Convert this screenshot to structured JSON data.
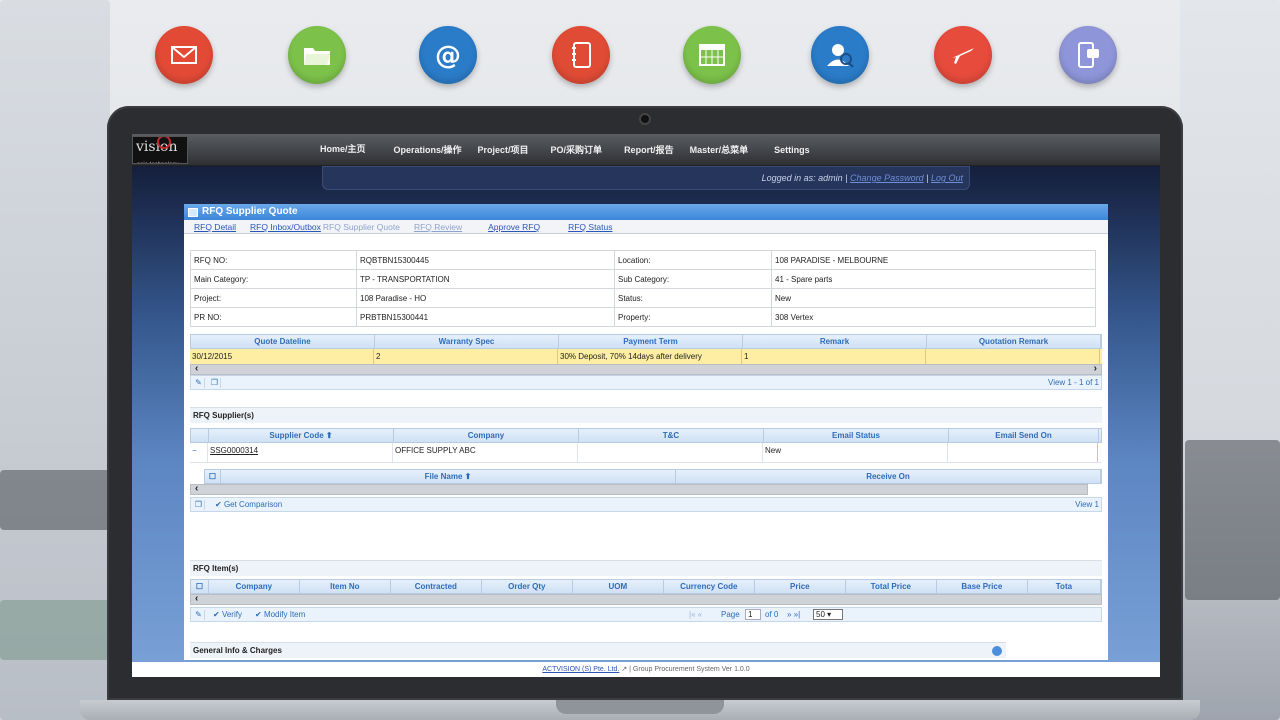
{
  "app_icons": [
    {
      "name": "mail-icon",
      "color": "#e24a36"
    },
    {
      "name": "folder-icon",
      "color": "#7cc24a"
    },
    {
      "name": "at-icon",
      "color": "#2a7bc8"
    },
    {
      "name": "notebook-icon",
      "color": "#e04b35"
    },
    {
      "name": "calendar-icon",
      "color": "#7cc24a"
    },
    {
      "name": "search-user-icon",
      "color": "#2a7bc8"
    },
    {
      "name": "plane-icon",
      "color": "#e64b3c"
    },
    {
      "name": "phone-chat-icon",
      "color": "#8e95d8"
    }
  ],
  "logo": {
    "text": "vision",
    "sub": "asia technology"
  },
  "nav": [
    "Home/主页",
    "Operations/操作",
    "Project/项目",
    "PO/采购订单",
    "Report/报告",
    "Master/总菜单",
    "Settings"
  ],
  "user": {
    "logged_in": "Logged in as: admin",
    "sep": "|",
    "change_password": "Change Password",
    "logout": "Log Out"
  },
  "panel": {
    "title": "RFQ Supplier Quote",
    "tabs": [
      "RFQ Detail",
      "RFQ Inbox/Outbox",
      "RFQ Supplier Quote",
      "RFQ Review",
      "Approve RFQ",
      "RFQ Status"
    ]
  },
  "info": {
    "rfq_no_label": "RFQ NO:",
    "rfq_no": "RQBTBN15300445",
    "location_label": "Location:",
    "location": "108 PARADISE - MELBOURNE",
    "main_cat_label": "Main Category:",
    "main_cat": "TP - TRANSPORTATION",
    "sub_cat_label": "Sub Category:",
    "sub_cat": "41 - Spare parts",
    "project_label": "Project:",
    "project": "108 Paradise - HO",
    "status_label": "Status:",
    "status": "New",
    "pr_no_label": "PR NO:",
    "pr_no": "PRBTBN15300441",
    "property_label": "Property:",
    "property": "308 Vertex"
  },
  "quote_grid": {
    "headers": [
      "Quote Dateline",
      "Warranty Spec",
      "Payment Term",
      "Remark",
      "Quotation Remark"
    ],
    "row": [
      "30/12/2015",
      "2",
      "30% Deposit, 70% 14days after delivery",
      "1",
      ""
    ],
    "view": "View 1 - 1 of 1"
  },
  "suppliers": {
    "title": "RFQ Supplier(s)",
    "headers": [
      "Supplier Code ⬆",
      "Company",
      "T&C",
      "Email Status",
      "Email Send On"
    ],
    "row": [
      "SSG0000314",
      "OFFICE SUPPLY ABC",
      "",
      "New",
      ""
    ],
    "file_headers": [
      "File Name ⬆",
      "Receive On"
    ],
    "get_comparison": "Get Comparison",
    "view": "View 1"
  },
  "items": {
    "title": "RFQ Item(s)",
    "headers": [
      "Company",
      "Item No",
      "Contracted",
      "Order Qty",
      "UOM",
      "Currency Code",
      "Price",
      "Total Price",
      "Base Price",
      "Tota"
    ],
    "verify": "Verify",
    "modify": "Modify Item",
    "page_label": "Page",
    "page_value": "1",
    "of_label": "of 0",
    "page_size": "50"
  },
  "general": {
    "title": "General Info & Charges"
  },
  "footer": {
    "company": "ACTVISION (S) Pte. Ltd.",
    "text": "| Group Procurement System Ver 1.0.0"
  }
}
